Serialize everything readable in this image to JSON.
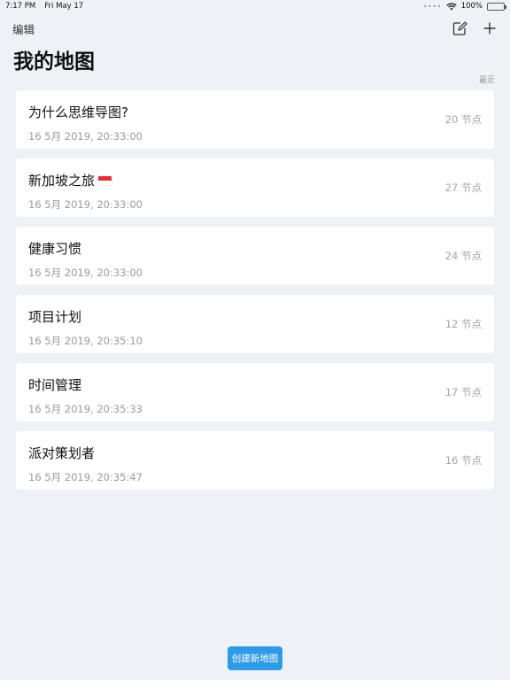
{
  "status_bar": {
    "time": "7:17 PM",
    "date": "Fri May 17",
    "battery": "100%"
  },
  "nav": {
    "edit_label": "编辑",
    "compose_icon": "compose-icon",
    "add_icon": "plus-icon"
  },
  "page_title": "我的地图",
  "sort_label": "最近",
  "maps": [
    {
      "name": "为什么思维导图?",
      "date": "16 5月 2019, 20:33:00",
      "nodes": "20 节点",
      "flag": false
    },
    {
      "name": "新加坡之旅",
      "date": "16 5月 2019, 20:33:00",
      "nodes": "27 节点",
      "flag": true
    },
    {
      "name": "健康习惯",
      "date": "16 5月 2019, 20:33:00",
      "nodes": "24 节点",
      "flag": false
    },
    {
      "name": "项目计划",
      "date": "16 5月 2019, 20:35:10",
      "nodes": "12 节点",
      "flag": false
    },
    {
      "name": "时间管理",
      "date": "16 5月 2019, 20:35:33",
      "nodes": "17 节点",
      "flag": false
    },
    {
      "name": "派对策划者",
      "date": "16 5月 2019, 20:35:47",
      "nodes": "16 节点",
      "flag": false
    }
  ],
  "create_button_label": "创建新地图",
  "colors": {
    "background": "#eef2f6",
    "card": "#ffffff",
    "accent": "#2f9ae8",
    "muted_text": "#9a9a9a"
  }
}
